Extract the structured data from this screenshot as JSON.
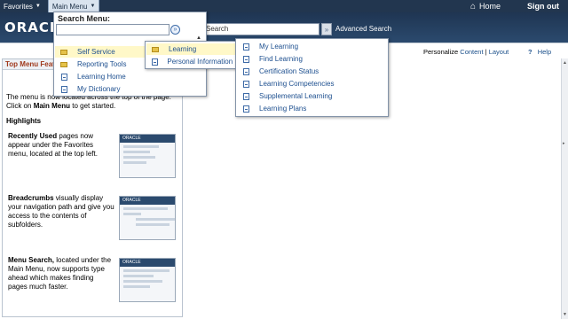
{
  "topbar": {
    "favorites": "Favorites",
    "main_menu": "Main Menu",
    "home": "Home",
    "sign_out": "Sign out"
  },
  "header": {
    "logo_text": "ORACLE",
    "search_placeholder": "Search",
    "advanced_search": "Advanced Search"
  },
  "personalize": {
    "label": "Personalize",
    "content": "Content",
    "separator": "|",
    "layout": "Layout",
    "help": "Help"
  },
  "pagelet": {
    "title": "Top Menu Features",
    "intro_line1": "The menu is now located across the top of the page.",
    "intro_line2_pre": "Click on ",
    "intro_line2_bold": "Main Menu",
    "intro_line2_post": " to get started.",
    "highlights": "Highlights",
    "features": [
      {
        "bold": "Recently Used",
        "text": " pages now appear under the Favorites menu, located at the top left."
      },
      {
        "bold": "Breadcrumbs",
        "text": " visually display your navigation path and give you access to the contents of subfolders."
      },
      {
        "bold": "Menu Search,",
        "text": " located under the Main Menu, now supports type ahead which makes finding pages much faster."
      }
    ],
    "thumb_brand": "ORACLE"
  },
  "main_menu_dropdown": {
    "label": "Search Menu:",
    "items": [
      {
        "label": "Self Service",
        "icon": "folder-icon"
      },
      {
        "label": "Reporting Tools",
        "icon": "folder-icon"
      },
      {
        "label": "Learning Home",
        "icon": "document-icon"
      },
      {
        "label": "My Dictionary",
        "icon": "document-icon"
      }
    ]
  },
  "self_service_flyout": {
    "items": [
      {
        "label": "Learning",
        "icon": "folder-icon"
      },
      {
        "label": "Personal Information Home",
        "icon": "document-icon"
      }
    ]
  },
  "learning_flyout": {
    "items": [
      {
        "label": "My Learning"
      },
      {
        "label": "Find Learning"
      },
      {
        "label": "Certification Status"
      },
      {
        "label": "Learning Competencies"
      },
      {
        "label": "Supplemental Learning"
      },
      {
        "label": "Learning Plans"
      }
    ]
  },
  "colors": {
    "topbar": "#22364f",
    "link": "#1d4f8f",
    "highlight": "#fff8c8",
    "pagelet_title": "#a0391c"
  }
}
